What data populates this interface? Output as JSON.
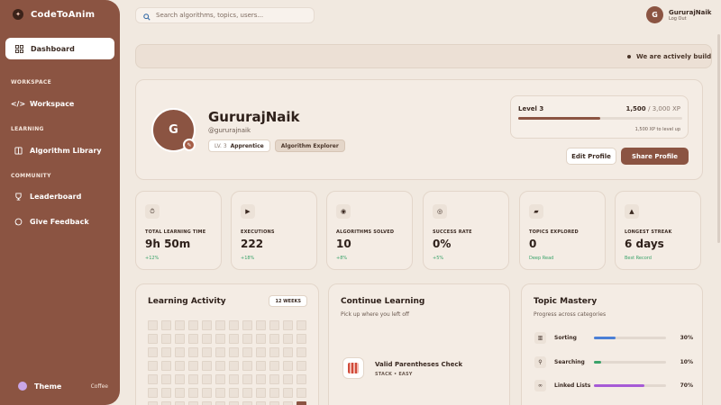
{
  "brand": {
    "name": "CodeToAnim"
  },
  "sidebar": {
    "active": {
      "label": "Dashboard"
    },
    "sections": [
      {
        "title": "WORKSPACE",
        "items": [
          {
            "label": "Workspace"
          }
        ]
      },
      {
        "title": "LEARNING",
        "items": [
          {
            "label": "Algorithm Library"
          }
        ]
      },
      {
        "title": "COMMUNITY",
        "items": [
          {
            "label": "Leaderboard"
          },
          {
            "label": "Give Feedback"
          }
        ]
      }
    ],
    "theme": {
      "label": "Theme",
      "value": "Coffee"
    }
  },
  "search": {
    "placeholder": "Search algorithms, topics, users..."
  },
  "user": {
    "initial": "G",
    "name": "GururajNaik",
    "logout": "Log Out"
  },
  "banner": {
    "text": "We are actively buildi"
  },
  "profile": {
    "initial": "G",
    "name": "GururajNaik",
    "handle": "@gururajnaik",
    "level_badge": {
      "prefix": "LV. 3",
      "label": "Apprentice"
    },
    "title_badge": "Algorithm Explorer",
    "level": {
      "label": "Level 3",
      "xp": "1,500",
      "xp_total": "/ 3,000 XP",
      "progress": 0.5,
      "note": "1,500 XP to level up"
    },
    "edit_label": "Edit Profile",
    "share_label": "Share Profile"
  },
  "stats": [
    {
      "icon": "stopwatch-icon",
      "glyph": "⏱",
      "label": "TOTAL LEARNING TIME",
      "value": "9h 50m",
      "sub": "+12%"
    },
    {
      "icon": "play-icon",
      "glyph": "▶",
      "label": "EXECUTIONS",
      "value": "222",
      "sub": "+18%"
    },
    {
      "icon": "brain-icon",
      "glyph": "◉",
      "label": "ALGORITHMS SOLVED",
      "value": "10",
      "sub": "+8%"
    },
    {
      "icon": "target-icon",
      "glyph": "◎",
      "label": "SUCCESS RATE",
      "value": "0%",
      "sub": "+5%"
    },
    {
      "icon": "folder-icon",
      "glyph": "▰",
      "label": "TOPICS EXPLORED",
      "value": "0",
      "sub": "Deep Read"
    },
    {
      "icon": "flame-icon",
      "glyph": "▲",
      "label": "LONGEST STREAK",
      "value": "6 days",
      "sub": "Best Record"
    }
  ],
  "activity": {
    "title": "Learning Activity",
    "range": "12 WEEKS"
  },
  "continue": {
    "title": "Continue Learning",
    "subtitle": "Pick up where you left off",
    "item": {
      "title": "Valid Parentheses Check",
      "meta": "STACK • EASY"
    }
  },
  "mastery": {
    "title": "Topic Mastery",
    "subtitle": "Progress across categories",
    "topics": [
      {
        "icon": "bar-chart-icon",
        "glyph": "▥",
        "label": "Sorting",
        "pct": "30%",
        "value": 0.3,
        "color": "#4a7fd6"
      },
      {
        "icon": "search-icon",
        "glyph": "⚲",
        "label": "Searching",
        "pct": "10%",
        "value": 0.1,
        "color": "#3aa36a"
      },
      {
        "icon": "link-icon",
        "glyph": "∞",
        "label": "Linked Lists",
        "pct": "70%",
        "value": 0.7,
        "color": "#a65ad6"
      }
    ]
  }
}
